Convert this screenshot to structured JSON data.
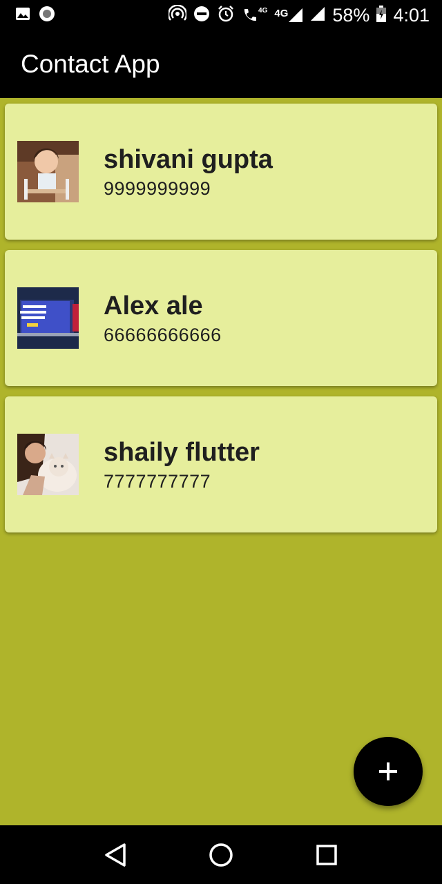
{
  "status_bar": {
    "network": "4G",
    "call_network": "4G",
    "battery": "58%",
    "time": "4:01",
    "icons": [
      "image-icon",
      "record-icon",
      "hotspot-icon",
      "dnd-icon",
      "alarm-icon",
      "wifi-call-icon",
      "signal-icon",
      "signal-icon",
      "battery-icon"
    ]
  },
  "app_bar": {
    "title": "Contact App"
  },
  "contacts": [
    {
      "name": "shivani gupta",
      "phone": "9999999999",
      "avatar": "girl-photo"
    },
    {
      "name": "Alex ale",
      "phone": "66666666666",
      "avatar": "laptop-photo"
    },
    {
      "name": "shaily flutter",
      "phone": "7777777777",
      "avatar": "woman-cat-photo"
    }
  ],
  "fab": {
    "icon": "plus-icon"
  },
  "nav_bar": {
    "icons": [
      "back-icon",
      "home-icon",
      "recents-icon"
    ]
  },
  "colors": {
    "background": "#afb42b",
    "card": "#e6ee9c",
    "appbar": "#000000",
    "fab": "#000000"
  }
}
